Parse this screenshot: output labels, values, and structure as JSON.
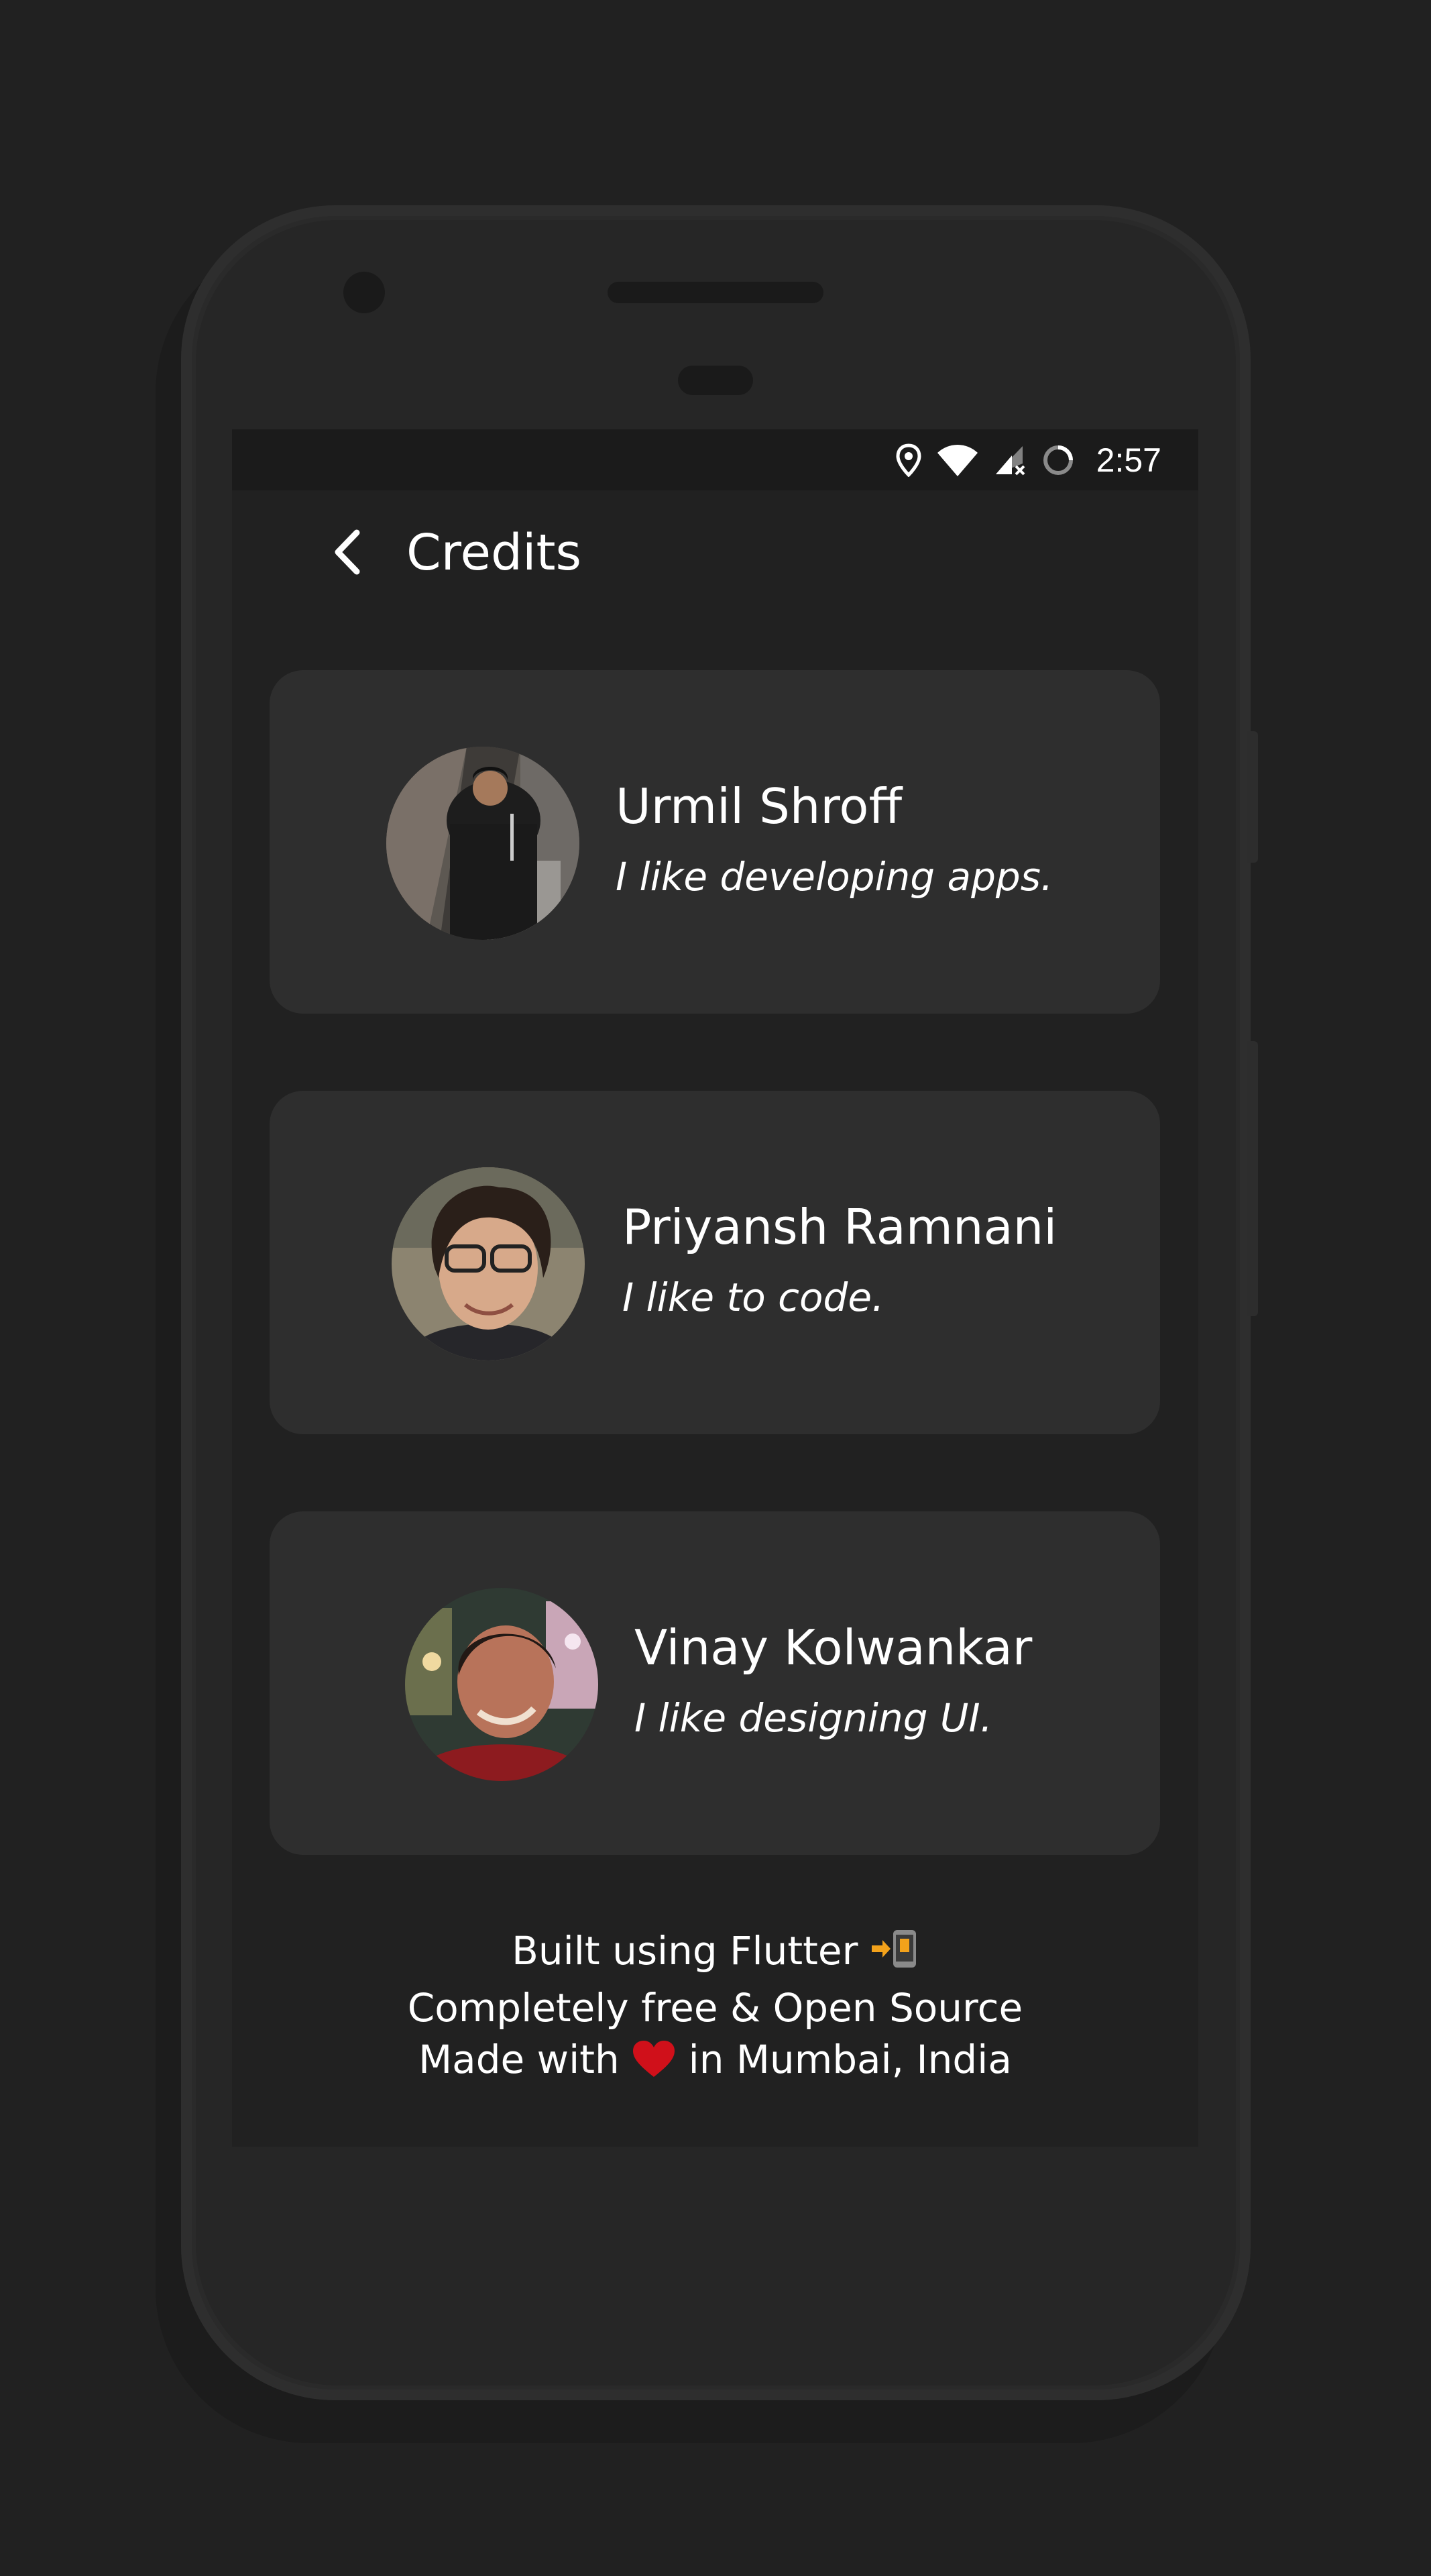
{
  "status_bar": {
    "time": "2:57",
    "icons": [
      "location-icon",
      "wifi-icon",
      "cell-signal-off-icon",
      "sync-circle-icon"
    ]
  },
  "header": {
    "back_icon": "chevron-left-icon",
    "title": "Credits"
  },
  "credits": [
    {
      "name": "Urmil Shroff",
      "tagline": "I like developing apps."
    },
    {
      "name": "Priyansh Ramnani",
      "tagline": "I like to code."
    },
    {
      "name": "Vinay Kolwankar",
      "tagline": "I like designing UI."
    }
  ],
  "footer": {
    "line1": "Built using Flutter",
    "line1_icon": "arrow-to-phone-icon",
    "line2": "Completely free & Open Source",
    "line3_prefix": "Made with",
    "line3_icon": "heart-icon",
    "line3_suffix": "in Mumbai, India"
  },
  "colors": {
    "background": "#212121",
    "card": "#2e2e2e",
    "status_bar": "#1b1b1b",
    "text": "#ffffff",
    "heart": "#d0101a"
  }
}
